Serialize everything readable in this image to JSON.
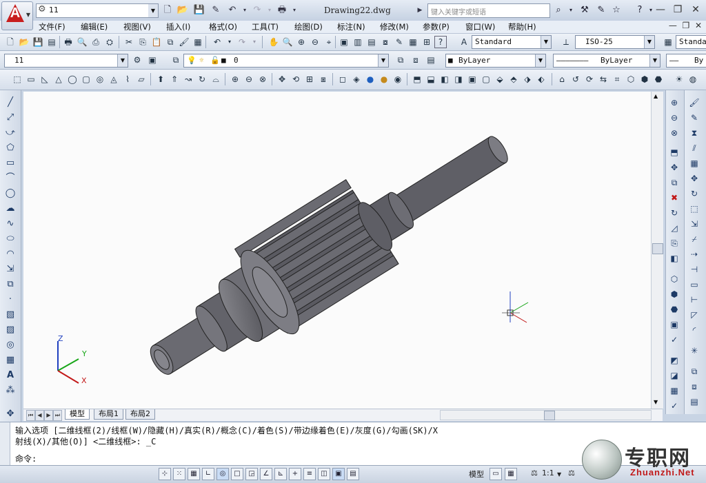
{
  "app": {
    "doc_title": "Drawing22.dwg",
    "workspace_value": "11",
    "search_placeholder": "键入关键字或短语"
  },
  "menu": [
    "文件(F)",
    "编辑(E)",
    "视图(V)",
    "插入(I)",
    "格式(O)",
    "工具(T)",
    "绘图(D)",
    "标注(N)",
    "修改(M)",
    "参数(P)",
    "窗口(W)",
    "帮助(H)"
  ],
  "toolbar2": {
    "text_style": "Standard",
    "dim_style": "ISO-25",
    "table_style": "Standa"
  },
  "toolbar3": {
    "workspace_combo": "11",
    "layer_combo": "0",
    "color_combo": "ByLayer",
    "linetype_combo": "ByLayer",
    "lineweight_combo": "By"
  },
  "layout_tabs": [
    "模型",
    "布局1",
    "布局2"
  ],
  "command": {
    "line1": "输入选项 [二维线框(2)/线框(W)/隐藏(H)/真实(R)/概念(C)/着色(S)/带边缘着色(E)/灰度(G)/勾画(SK)/X",
    "line2": "射线(X)/其他(O)] <二维线框>: _C",
    "prompt": "命令:"
  },
  "status": {
    "model_label": "模型",
    "scale": "1:1"
  },
  "ucs": {
    "x": "X",
    "y": "Y",
    "z": "Z"
  },
  "watermark": {
    "cn": "专职网",
    "en": "Zhuanzhi.Net"
  }
}
